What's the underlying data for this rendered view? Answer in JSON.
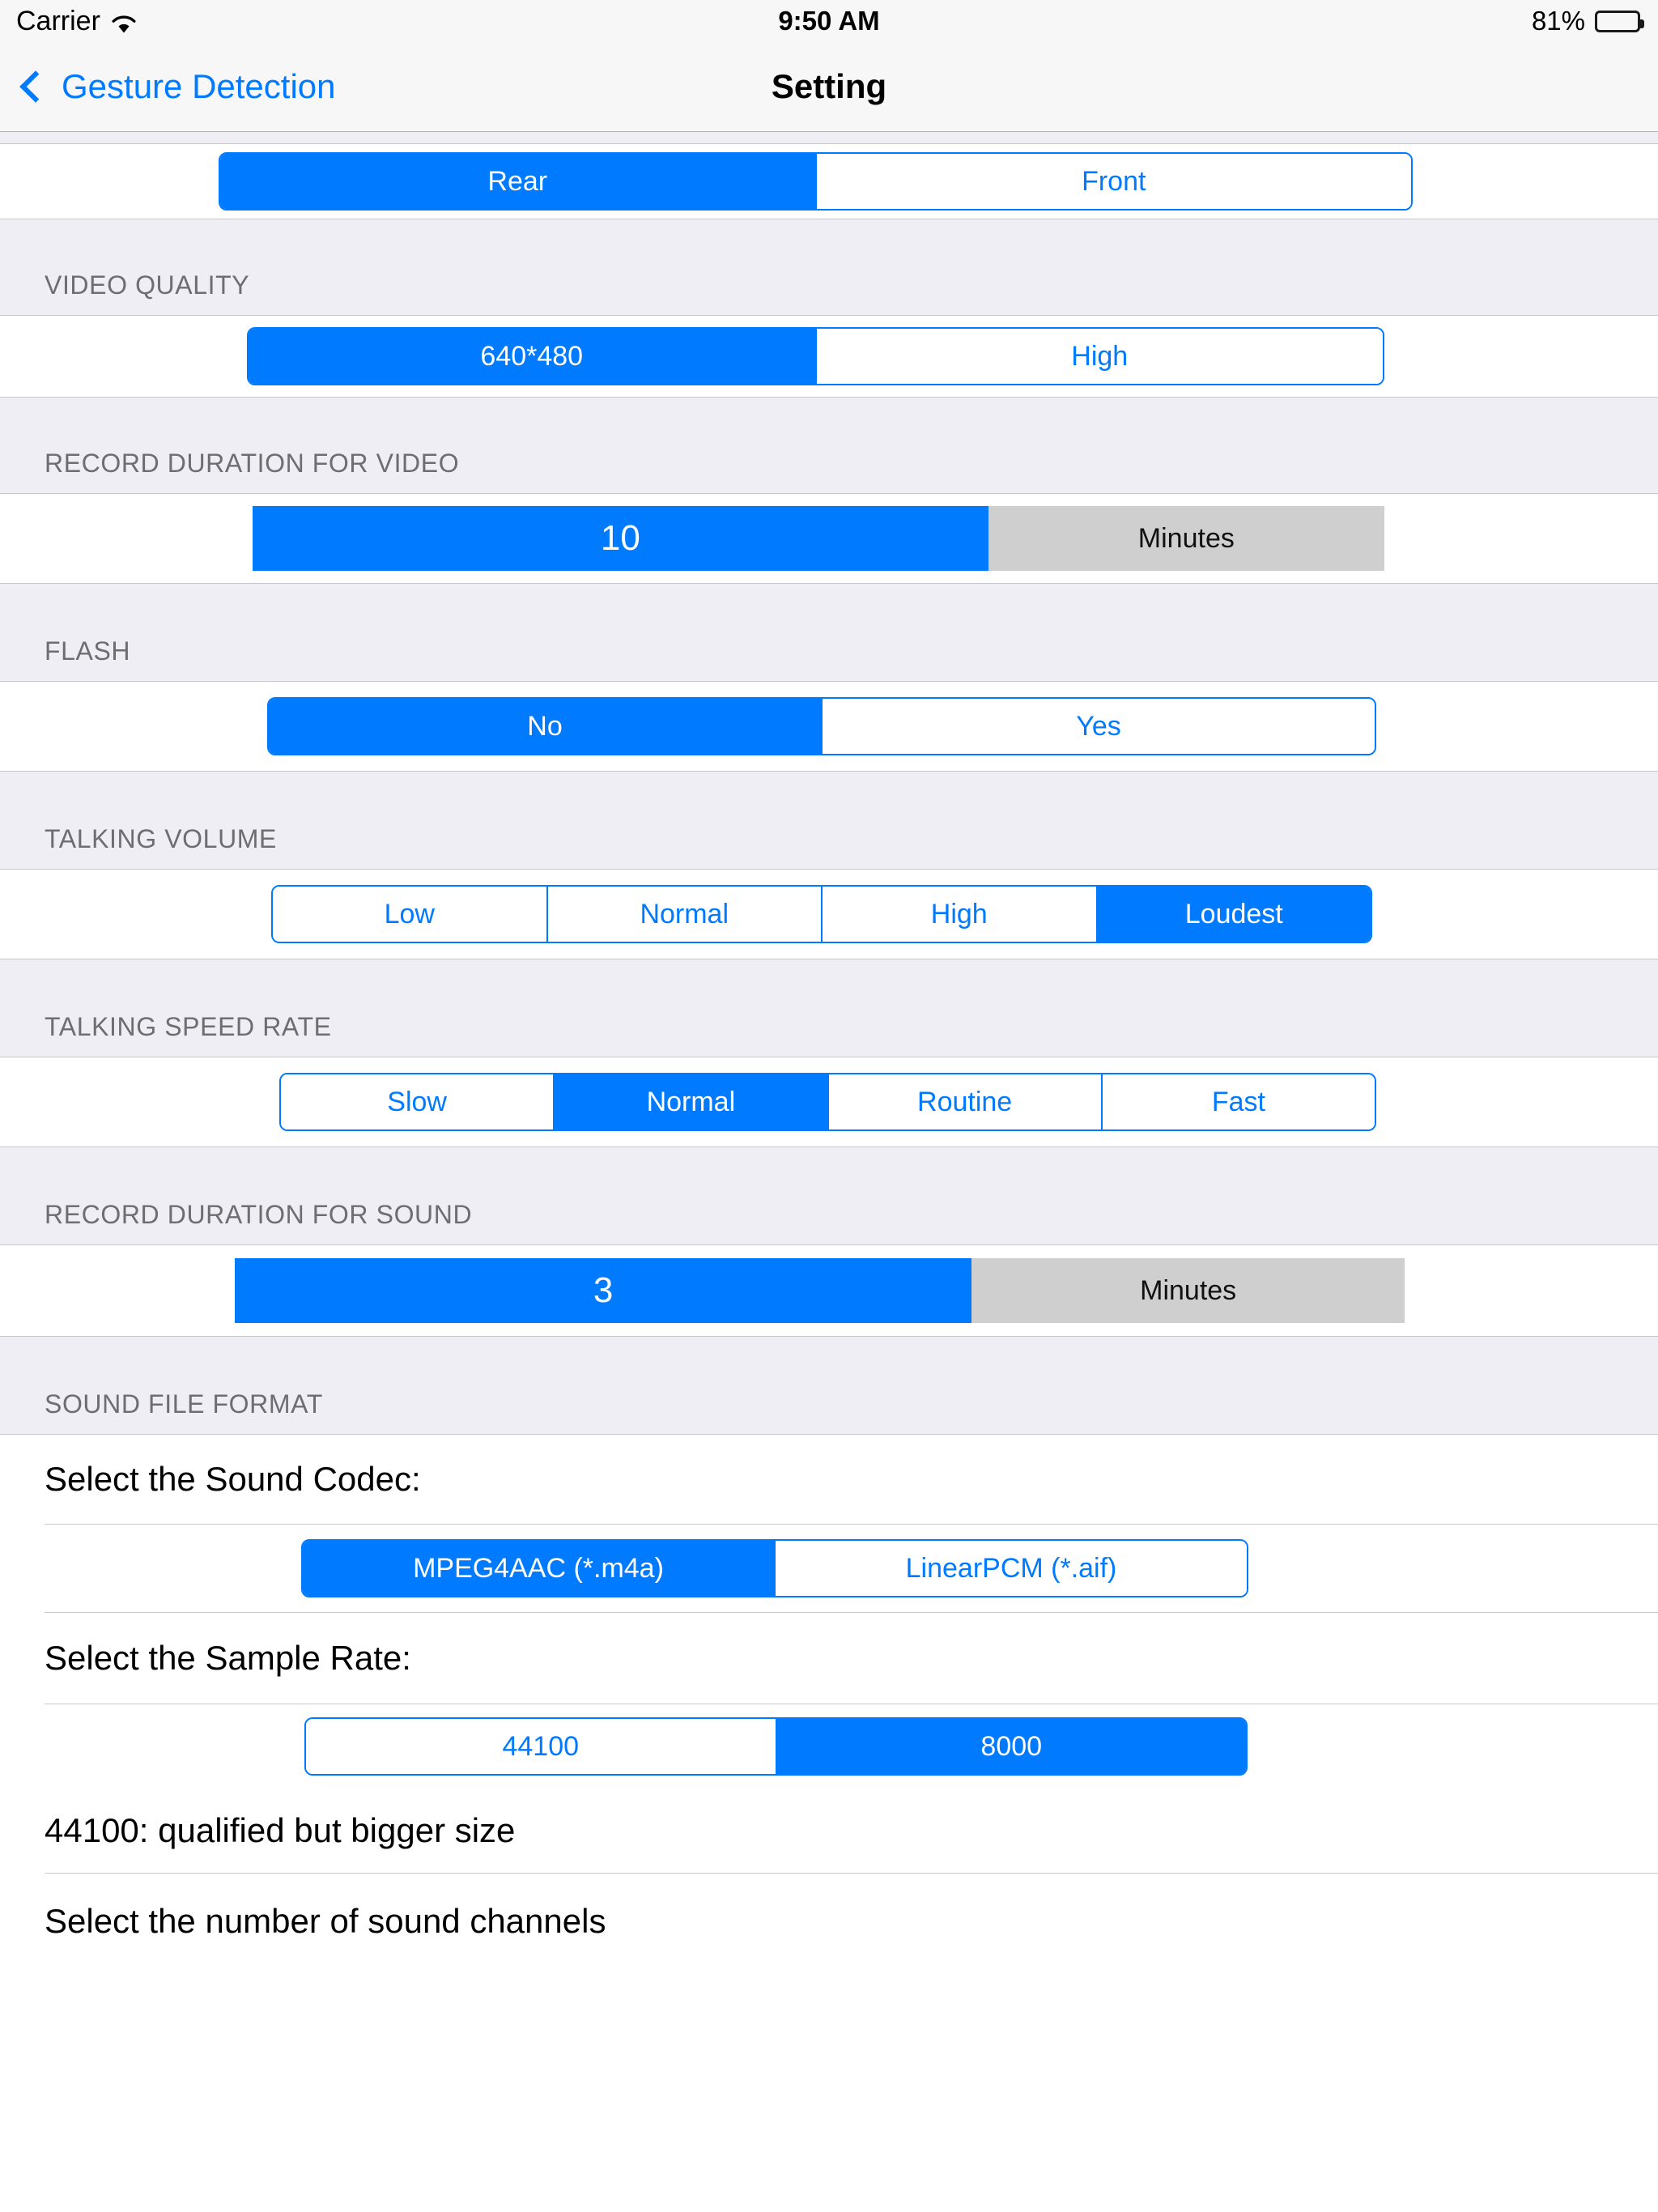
{
  "status_bar": {
    "carrier": "Carrier",
    "wifi_icon": "wifi-icon",
    "time": "9:50 AM",
    "battery_percent": "81%",
    "battery_icon": "battery-icon",
    "battery_level": 81
  },
  "nav_bar": {
    "back_label": "Gesture Detection",
    "back_icon": "chevron-left-icon",
    "title": "Setting"
  },
  "sections": {
    "camera": {
      "header": "",
      "segments": [
        "Rear",
        "Front"
      ],
      "selected": 0
    },
    "video_quality": {
      "header": "VIDEO QUALITY",
      "segments": [
        "640*480",
        "High"
      ],
      "selected": 0
    },
    "record_duration_video": {
      "header": "RECORD DURATION FOR VIDEO",
      "value": "10",
      "unit": "Minutes"
    },
    "flash": {
      "header": "FLASH",
      "segments": [
        "No",
        "Yes"
      ],
      "selected": 0
    },
    "talking_volume": {
      "header": "TALKING VOLUME",
      "segments": [
        "Low",
        "Normal",
        "High",
        "Loudest"
      ],
      "selected": 3
    },
    "talking_speed_rate": {
      "header": "TALKING SPEED RATE",
      "segments": [
        "Slow",
        "Normal",
        "Routine",
        "Fast"
      ],
      "selected": 1
    },
    "record_duration_sound": {
      "header": "RECORD DURATION FOR SOUND",
      "value": "3",
      "unit": "Minutes"
    },
    "sound_file_format": {
      "header": "SOUND FILE FORMAT",
      "codec_label": "Select the Sound Codec:",
      "codec_segments": [
        "MPEG4AAC (*.m4a)",
        "LinearPCM (*.aif)"
      ],
      "codec_selected": 0,
      "sample_rate_label": "Select the Sample Rate:",
      "sample_rate_segments": [
        "44100",
        "8000"
      ],
      "sample_rate_selected": 1,
      "sample_rate_note": "44100: qualified but bigger size",
      "channels_label": "Select the number of sound channels"
    }
  },
  "colors": {
    "accent": "#007AFF",
    "group_bg": "#EFEEF4",
    "separator": "#C8C7CC",
    "header_text": "#6D6D72",
    "stepper_unit_bg": "#CFCFCF"
  }
}
